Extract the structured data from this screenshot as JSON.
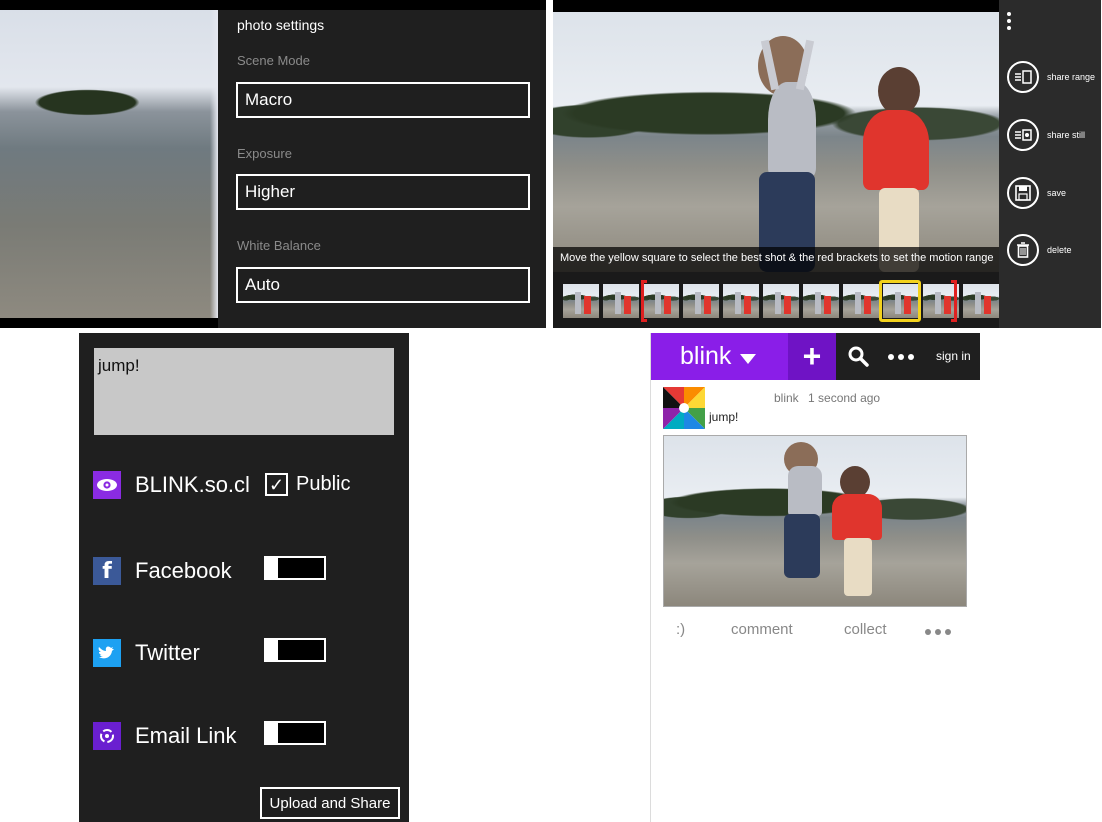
{
  "camera_settings": {
    "title": "photo settings",
    "scene_mode": {
      "label": "Scene Mode",
      "value": "Macro"
    },
    "exposure": {
      "label": "Exposure",
      "value": "Higher"
    },
    "white_balance": {
      "label": "White Balance",
      "value": "Auto"
    }
  },
  "editor": {
    "instruction": "Move the yellow square to select the best shot & the red brackets to set the motion range",
    "actions": [
      {
        "label": "share range",
        "icon": "share-range-icon"
      },
      {
        "label": "share still",
        "icon": "share-still-icon"
      },
      {
        "label": "save",
        "icon": "save-icon"
      },
      {
        "label": "delete",
        "icon": "delete-icon"
      }
    ],
    "colors": {
      "selector": "#f3d21c",
      "bracket": "#e02020"
    }
  },
  "share": {
    "caption": "jump!",
    "services": [
      {
        "label": "BLINK.so.cl",
        "icon": "eye-icon",
        "color": "#8a2be2"
      },
      {
        "label": "Facebook",
        "icon": "facebook-icon",
        "color": "#3b5998",
        "enabled": false
      },
      {
        "label": "Twitter",
        "icon": "twitter-icon",
        "color": "#1da1f2",
        "enabled": false
      },
      {
        "label": "Email Link",
        "icon": "link-icon",
        "color": "#6a1fd0",
        "enabled": false
      }
    ],
    "public_label": "Public",
    "public_checked": true,
    "upload_label": "Upload and Share"
  },
  "feed": {
    "brand": "blink",
    "sign_in": "sign in",
    "post": {
      "author": "blink",
      "time": "1 second ago",
      "text": "jump!"
    },
    "actions": {
      "smiley": ":)",
      "comment": "comment",
      "collect": "collect"
    },
    "colors": {
      "brand": "#8a1ee8",
      "plus": "#6f13c5"
    }
  }
}
